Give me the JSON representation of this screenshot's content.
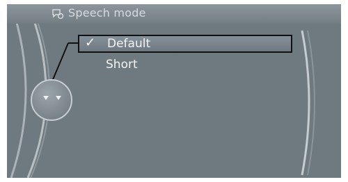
{
  "header": {
    "title": "Speech mode",
    "icon": "speech-settings-icon"
  },
  "menu": {
    "items": [
      {
        "label": "Default",
        "checked": true,
        "selected": true
      },
      {
        "label": "Short",
        "checked": false,
        "selected": false
      }
    ],
    "check_glyph": "✓"
  },
  "controller": {
    "icon": "controller-knob-icon"
  },
  "colors": {
    "screen_bg": "#6f7a80",
    "text": "#f3f4f4",
    "title_text": "#d7dadc",
    "highlight_border": "#111111"
  }
}
